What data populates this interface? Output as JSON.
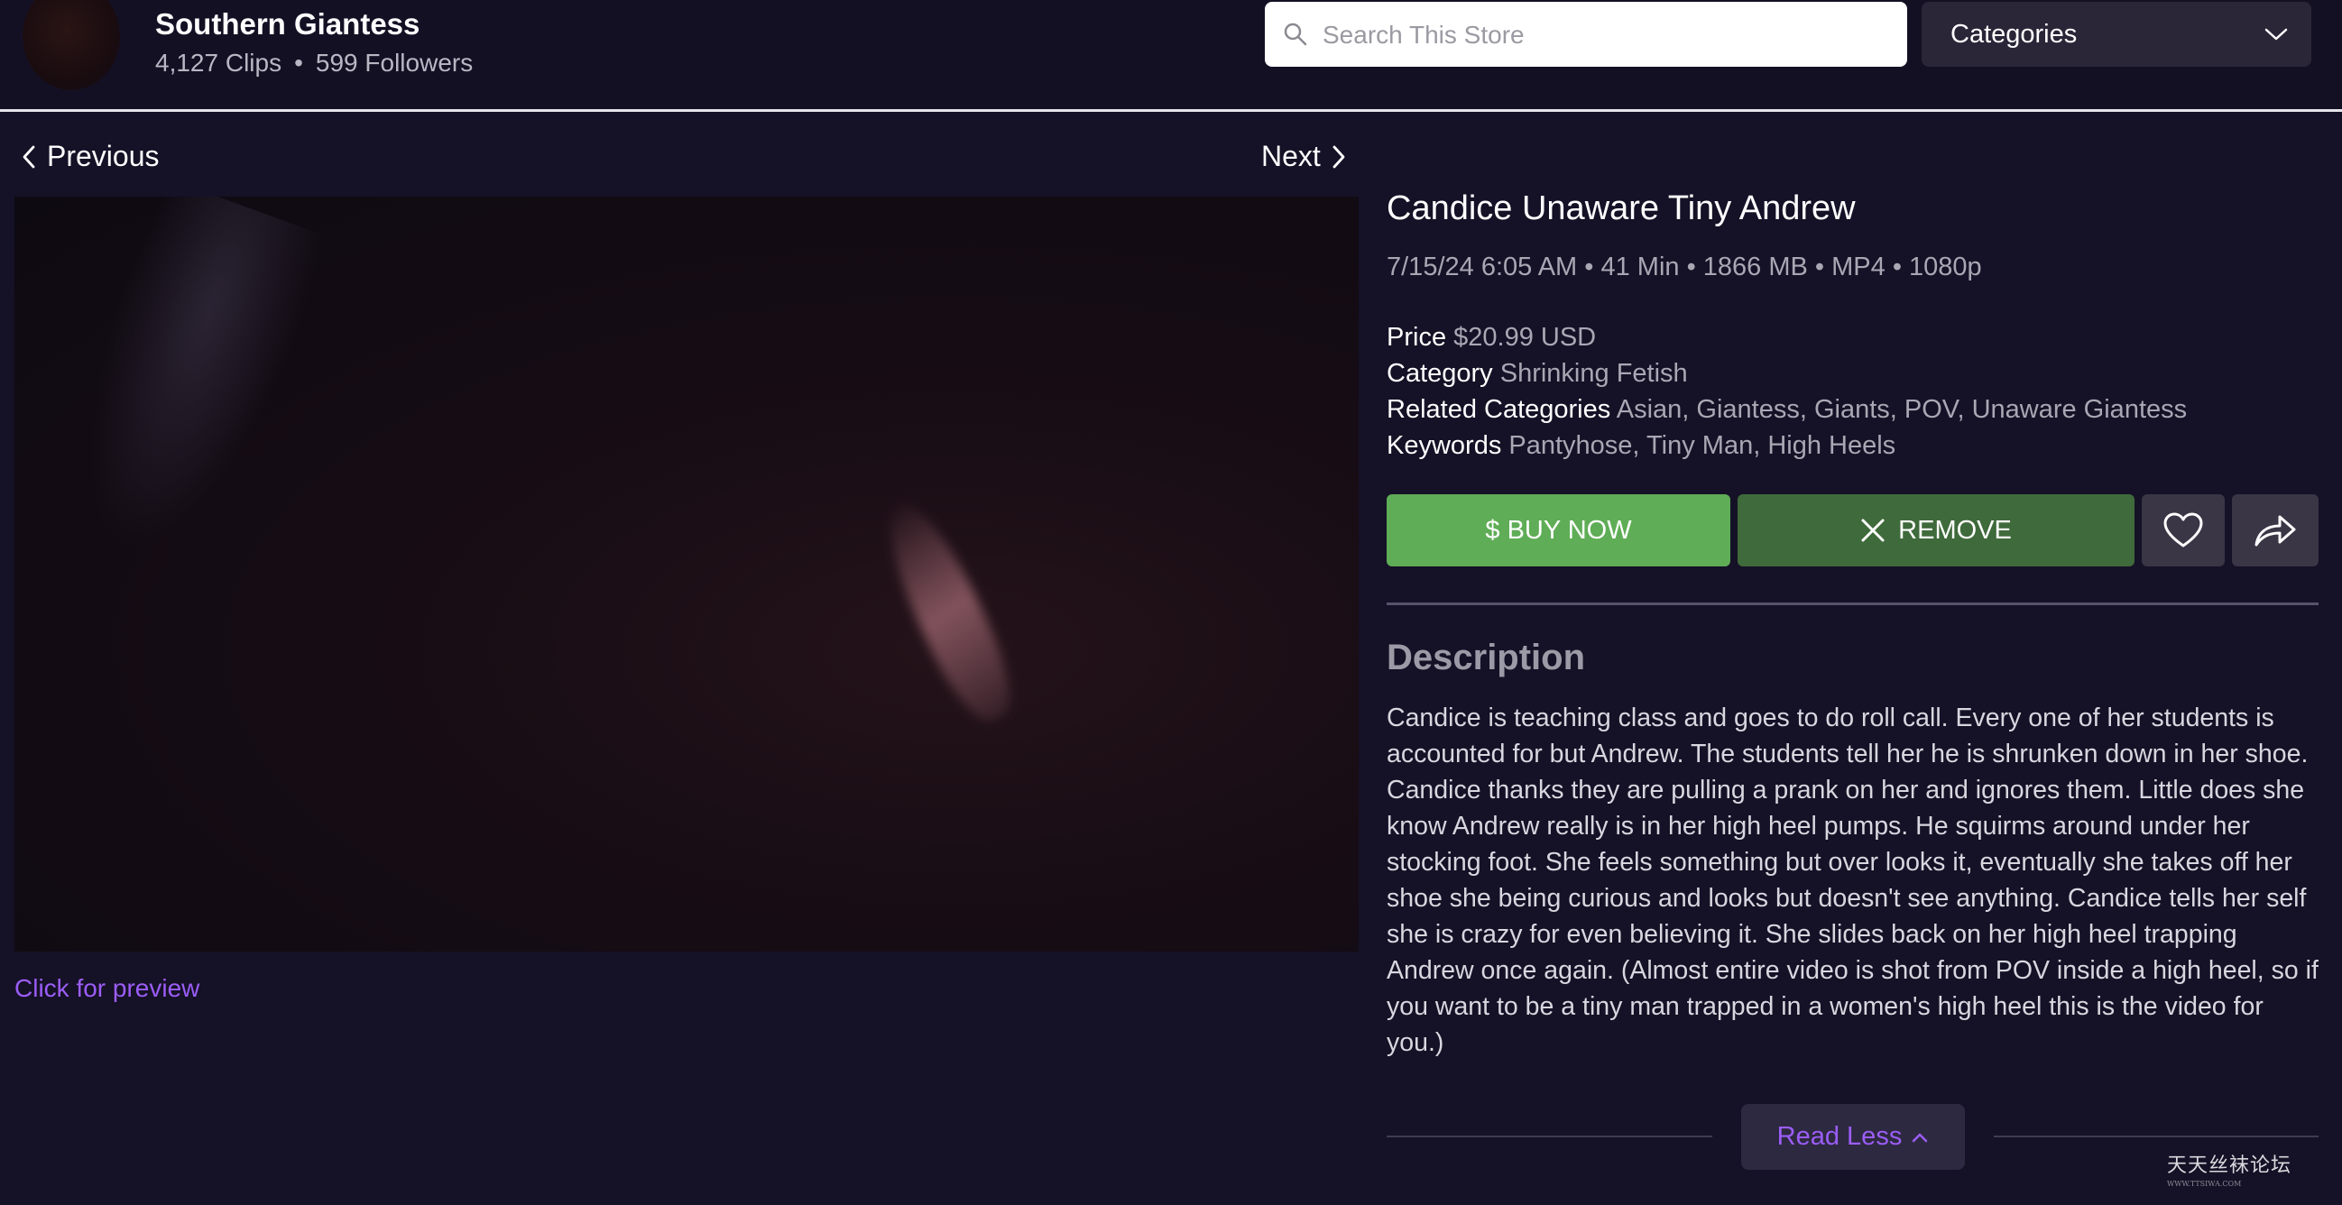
{
  "store": {
    "name": "Southern Giantess",
    "clips": "4,127 Clips",
    "separator": "•",
    "followers": "599 Followers"
  },
  "search": {
    "placeholder": "Search This Store"
  },
  "categories_dropdown": {
    "selected": "Categories"
  },
  "nav": {
    "previous": "Previous",
    "next": "Next"
  },
  "video": {
    "preview_link": "Click for preview"
  },
  "clip": {
    "title": "Candice Unaware Tiny Andrew",
    "meta": "7/15/24 6:05 AM • 41 Min • 1866 MB • MP4 • 1080p",
    "price_label": "Price",
    "price_value": "$20.99 USD",
    "category_label": "Category",
    "category_value": "Shrinking Fetish",
    "related_label": "Related Categories",
    "related_value": "Asian, Giantess, Giants, POV, Unaware Giantess",
    "keywords_label": "Keywords",
    "keywords_value": "Pantyhose, Tiny Man, High Heels"
  },
  "actions": {
    "buy_label": "$ BUY NOW",
    "remove_label": "REMOVE",
    "favorite_icon": "heart-icon",
    "share_icon": "share-icon"
  },
  "description": {
    "heading": "Description",
    "text": "Candice is teaching class and goes to do roll call. Every one of her students is accounted for but Andrew. The students tell her he is shrunken down in her shoe. Candice thanks they are pulling a prank on her and ignores them. Little does she know Andrew really is in her high heel pumps. He squirms around under her stocking foot. She feels something but over looks it, eventually she takes off her shoe she being curious and looks but doesn't see anything. Candice tells her self she is crazy for even believing it. She slides back on her high heel trapping Andrew once again. (Almost entire video is shot from POV inside a high heel, so if you want to be a tiny man trapped in a women's high heel this is the video for you.)",
    "read_less": "Read Less"
  },
  "watermark": {
    "text": "天天丝袜论坛",
    "sub": "WWW.TTSIWA.COM"
  },
  "colors": {
    "background": "#151126",
    "buy": "#5fad56",
    "remove": "#3f6a3b",
    "link": "#9b5df7"
  }
}
